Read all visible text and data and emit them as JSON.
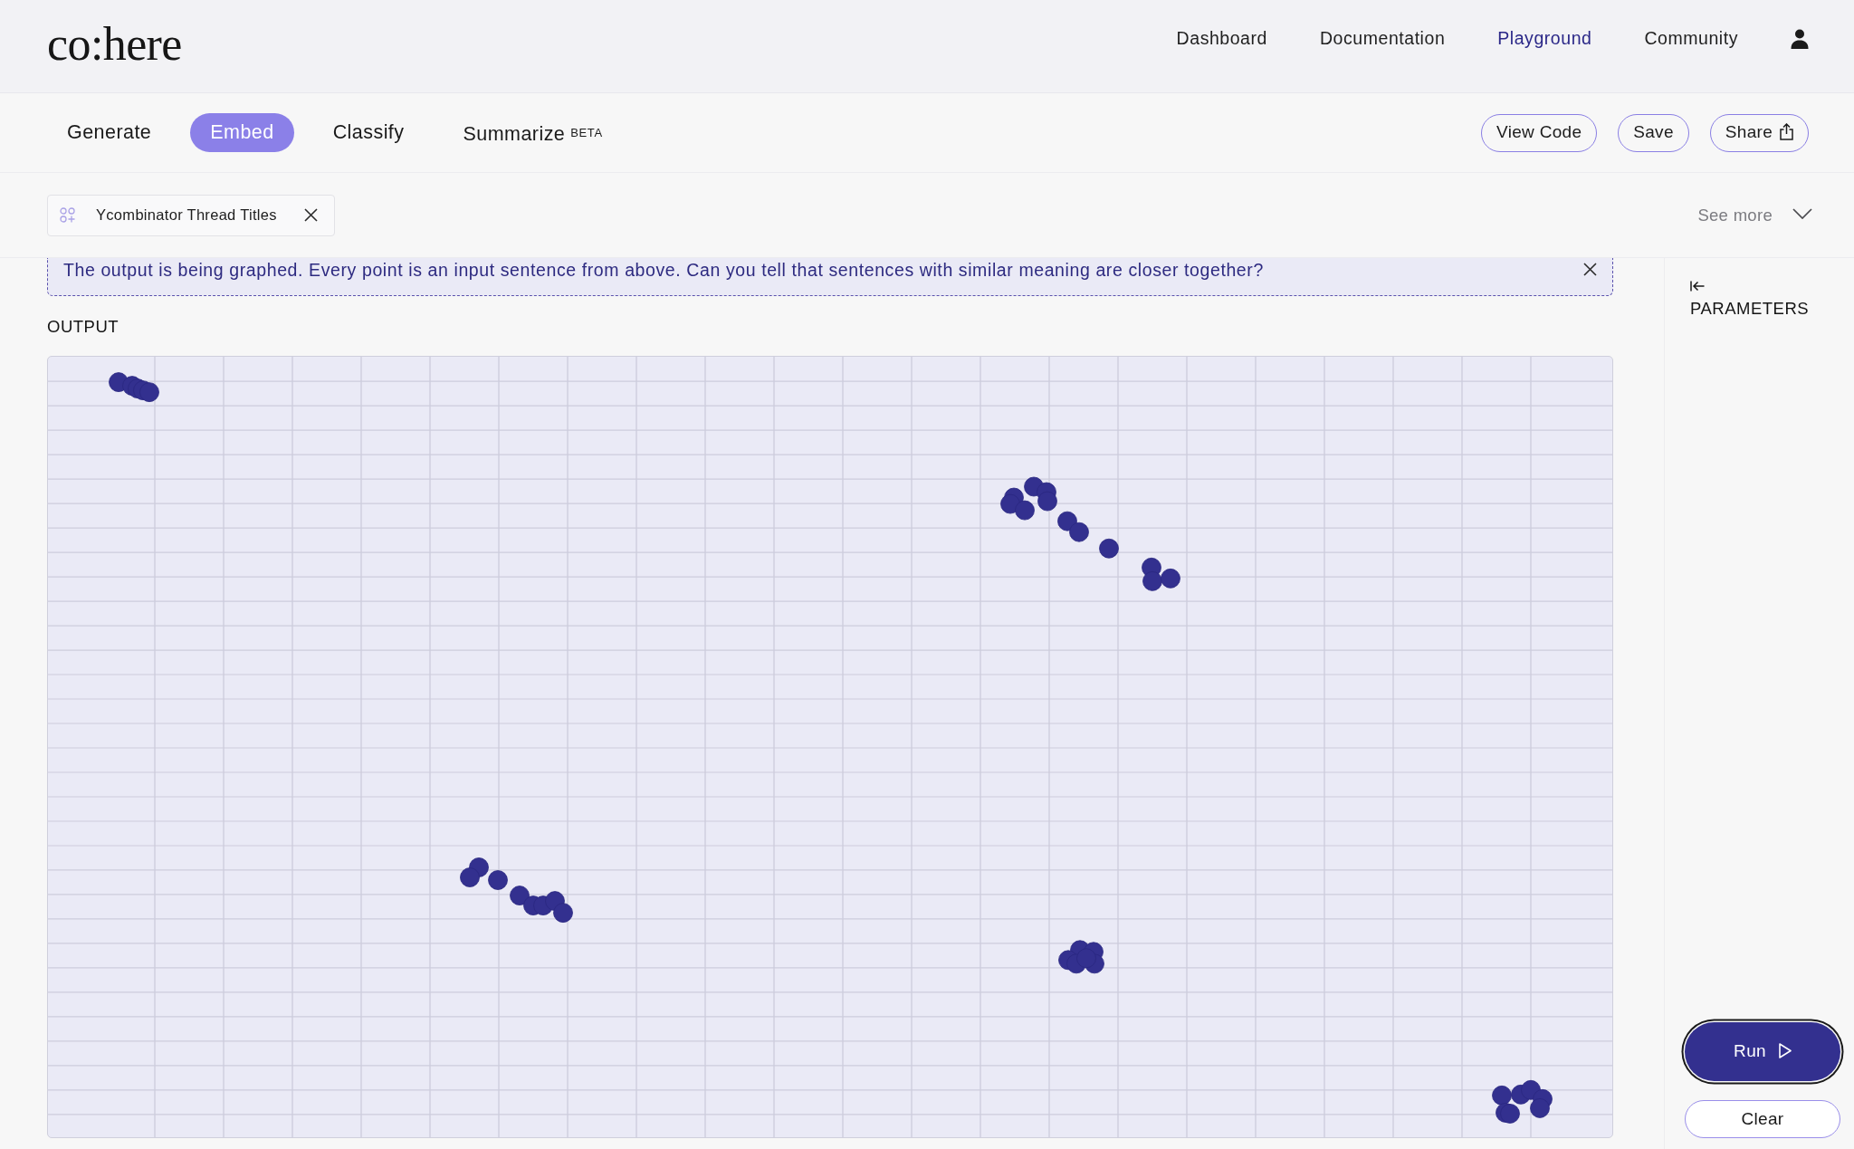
{
  "header": {
    "logo": "co:here",
    "nav": [
      {
        "label": "Dashboard",
        "selected": false
      },
      {
        "label": "Documentation",
        "selected": false
      },
      {
        "label": "Playground",
        "selected": true
      },
      {
        "label": "Community",
        "selected": false
      }
    ]
  },
  "tabs": [
    {
      "label": "Generate",
      "selected": false
    },
    {
      "label": "Embed",
      "selected": true
    },
    {
      "label": "Classify",
      "selected": false
    },
    {
      "label": "Summarize",
      "badge": "BETA",
      "selected": false
    }
  ],
  "actions": [
    {
      "label": "View Code",
      "kind": "plain"
    },
    {
      "label": "Save",
      "kind": "plain"
    },
    {
      "label": "Share",
      "kind": "share"
    }
  ],
  "dataset": {
    "label": "Ycombinator Thread Titles"
  },
  "see_more": {
    "label": "See more"
  },
  "notice": {
    "text": "The output is being graphed. Every point is an input sentence from above. Can you tell that sentences with similar meaning are closer together?"
  },
  "output": {
    "label": "OUTPUT"
  },
  "sidebar": {
    "title": "PARAMETERS",
    "buttons": [
      {
        "label": "Run",
        "kind": "primary",
        "focused": true
      },
      {
        "label": "Clear",
        "kind": "outline",
        "focused": false
      }
    ]
  }
}
